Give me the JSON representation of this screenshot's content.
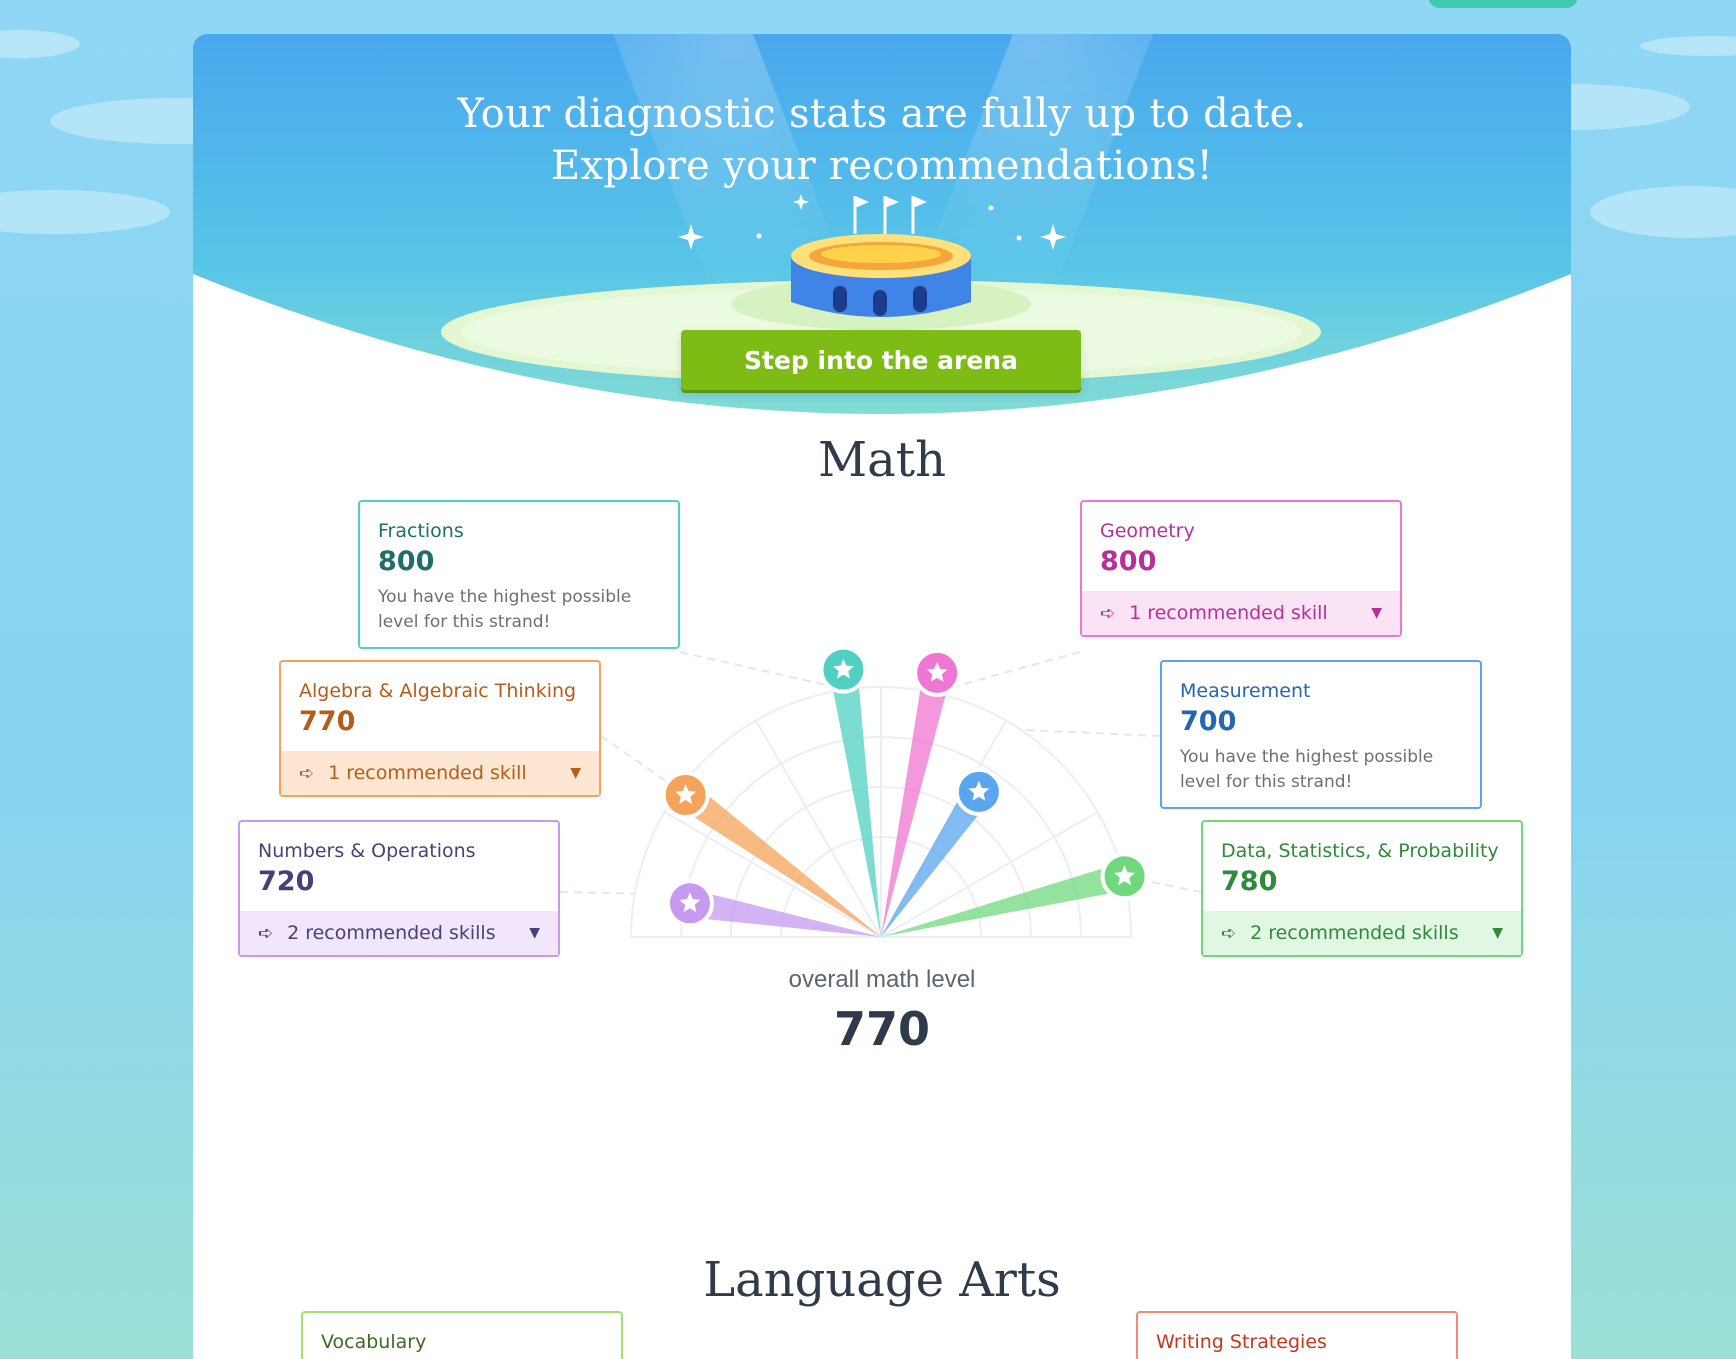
{
  "hero": {
    "headline_line1": "Your diagnostic stats are fully up to date.",
    "headline_line2": "Explore your recommendations!",
    "cta_label": "Step into the arena"
  },
  "math": {
    "title": "Math",
    "overall_label": "overall math level",
    "overall_value": "770",
    "strands": [
      {
        "name": "Fractions",
        "score": "800",
        "note": "You have the highest possible level for this strand!",
        "color": "#4fd0c3",
        "dark": "#1f6e6a"
      },
      {
        "name": "Geometry",
        "score": "800",
        "rec_label": "1 recommended skill",
        "color": "#ef76d2",
        "dark": "#b82f9a",
        "tint": "#fbe3f6"
      },
      {
        "name": "Algebra & Algebraic Thinking",
        "score": "770",
        "rec_label": "1 recommended skill",
        "color": "#f5a35a",
        "dark": "#b55d18",
        "tint": "#fde7d3"
      },
      {
        "name": "Measurement",
        "score": "700",
        "note": "You have the highest possible level for this strand!",
        "color": "#5aa6ee",
        "dark": "#2466b0"
      },
      {
        "name": "Numbers & Operations",
        "score": "720",
        "rec_label": "2 recommended skills",
        "color": "#c59af0",
        "dark": "#4a3f7a",
        "tint": "#f1e6fc"
      },
      {
        "name": "Data, Statistics, & Probability",
        "score": "780",
        "rec_label": "2 recommended skills",
        "color": "#6fd87c",
        "dark": "#2f8a3a",
        "tint": "#e1f7e3"
      }
    ]
  },
  "language_arts": {
    "title": "Language Arts",
    "strands": [
      {
        "name": "Vocabulary",
        "color": "#a6dc6e",
        "dark": "#3d6a1e"
      },
      {
        "name": "Writing Strategies",
        "color": "#f28a74",
        "dark": "#c7361c"
      }
    ]
  },
  "icons": {
    "rec_arrow": "➪",
    "caret": "▼"
  }
}
